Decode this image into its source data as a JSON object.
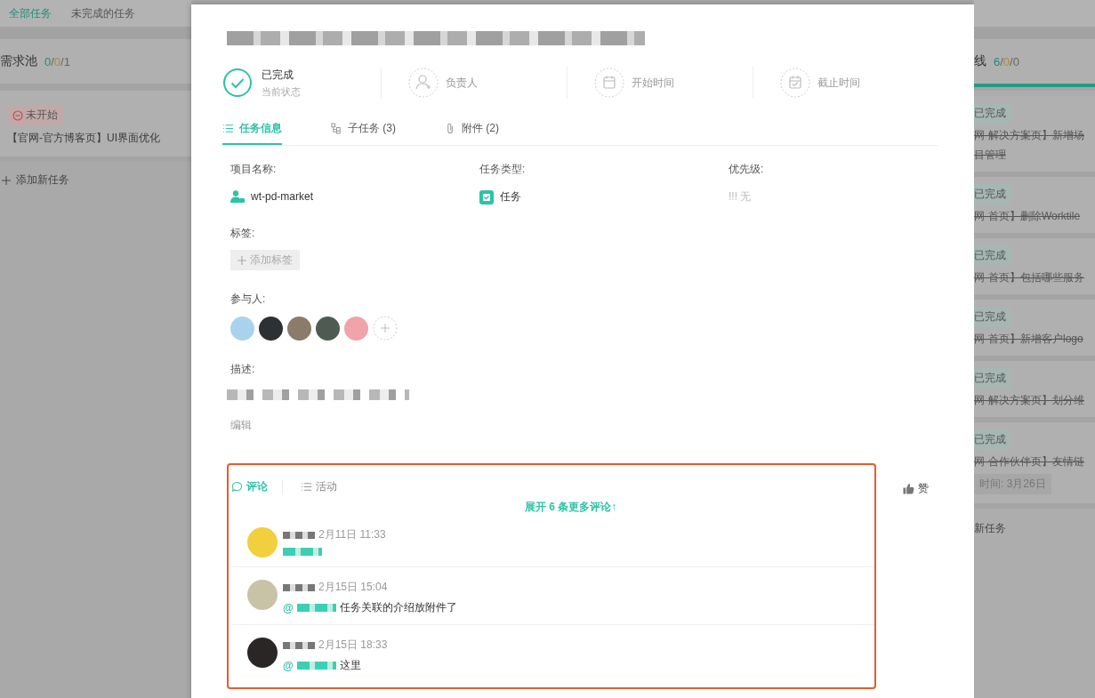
{
  "board_tabs": [
    {
      "label": "全部任务",
      "selected": true
    },
    {
      "label": "未完成的任务",
      "selected": false
    }
  ],
  "count_separator": "/",
  "left_column": {
    "title": "需求池",
    "counts": [
      "0",
      "0",
      "1"
    ],
    "tasks": [
      {
        "kind": "todo",
        "status": "未开始",
        "title_lines": [
          "【官网-官方博客页】UI界面优化"
        ]
      }
    ],
    "add_task": "添加新任务"
  },
  "right_column": {
    "title": "线",
    "counts": [
      "6",
      "0",
      "0"
    ],
    "tasks": [
      {
        "kind": "done",
        "status": "已完成",
        "title_lines": [
          "网-解决方案页】新增场",
          "目管理"
        ]
      },
      {
        "kind": "done",
        "status": "已完成",
        "title_lines": [
          "网-首页】删除Worktile"
        ]
      },
      {
        "kind": "done",
        "status": "已完成",
        "title_lines": [
          "网-首页】包括哪些服务"
        ]
      },
      {
        "kind": "done",
        "status": "已完成",
        "title_lines": [
          "网-首页】新增客户logo"
        ]
      },
      {
        "kind": "done",
        "status": "已完成",
        "title_lines": [
          "网-解决方案页】划分维"
        ]
      },
      {
        "kind": "done",
        "status": "已完成",
        "title_lines": [
          "网-合作伙伴页】友情链"
        ],
        "due": "时间: 3月26日"
      }
    ],
    "add_task": "新任务"
  },
  "task": {
    "status": {
      "label": "已完成",
      "caption": "当前状态",
      "done": true
    },
    "meta": [
      {
        "kind": "assignee",
        "label": "负责人"
      },
      {
        "kind": "start",
        "label": "开始时间"
      },
      {
        "kind": "due",
        "label": "截止时间"
      }
    ],
    "tabs": [
      {
        "kind": "info",
        "label": "任务信息",
        "selected": true
      },
      {
        "kind": "subtasks",
        "label": "子任务 (3)",
        "selected": false
      },
      {
        "kind": "files",
        "label": "附件 (2)",
        "selected": false
      }
    ],
    "project": {
      "label": "项目名称:",
      "value": "wt-pd-market"
    },
    "type": {
      "label": "任务类型:",
      "value": "任务"
    },
    "priority": {
      "label": "优先级:",
      "value": "!!! 无"
    },
    "tags": {
      "label": "标签:",
      "button": "添加标签"
    },
    "participants": {
      "label": "参与人:",
      "avatars": [
        {
          "color": "#a9d3ec"
        },
        {
          "color": "#2e3134"
        },
        {
          "color": "#8c7a6a"
        },
        {
          "color": "#4f5a52"
        },
        {
          "color": "#f0a3a8"
        }
      ]
    },
    "description": {
      "label": "描述:"
    },
    "edit": "编辑"
  },
  "comments": {
    "tabs": [
      {
        "kind": "comment",
        "label": "评论",
        "selected": true
      },
      {
        "kind": "activity",
        "label": "活动",
        "selected": false
      }
    ],
    "like": "赞",
    "expand": "展开 6 条更多评论↑",
    "items": [
      {
        "time": "2月11日 11:33",
        "color": "#f2cf3c"
      },
      {
        "time": "2月15日 15:04",
        "mention": "@",
        "text": "任务关联的介绍放附件了",
        "color": "#c8c2a6"
      },
      {
        "time": "2月15日 18:33",
        "mention": "@",
        "text": "这里",
        "color": "#2a2626"
      }
    ]
  }
}
